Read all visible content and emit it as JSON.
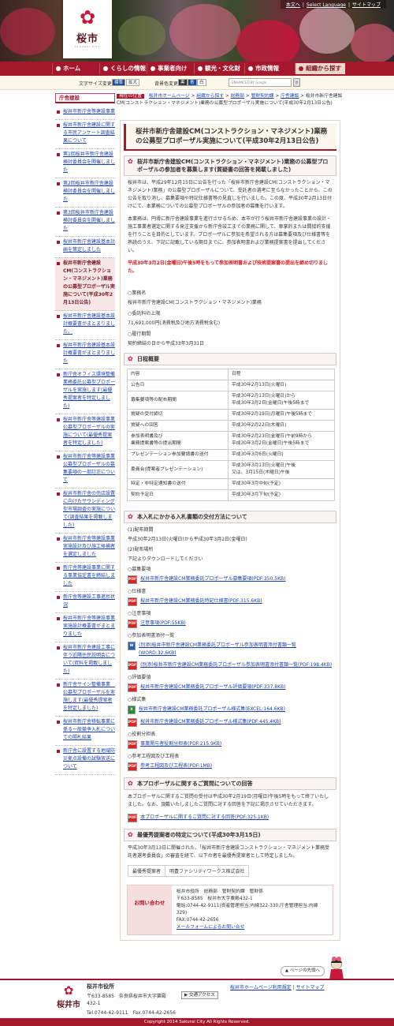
{
  "header": {
    "logo_name": "桜市",
    "logo_sub": "SAKURAI CITY",
    "top_links": [
      "本文へ",
      "Select Language",
      "サイトマップ"
    ]
  },
  "nav": [
    "ホーム",
    "くらしの情報",
    "事業者向け",
    "観光・文化財",
    "市政情報",
    "組織から探す"
  ],
  "toolbar": {
    "font_label": "文字サイズ変更",
    "font_std": "標準",
    "font_big": "拡大",
    "color_label": "背景色変更",
    "color_black": "黒",
    "color_blue": "青",
    "color_white": "白",
    "search_placeholder": "ENHANCED BY Google"
  },
  "sidebar": {
    "title": "庁舎建設",
    "items": [
      "桜井市新庁舎等建設事業",
      "桜井市新庁舎建設に関する市民アンケート調査結果について",
      "第1回桜井市新庁舎建設検討委員会を開催しました",
      "第2回桜井市新庁舎建設検討委員会を開催しました",
      "第3回桜井市新庁舎建設検討委員会を開催しました",
      "桜井市新庁舎建設基本計画を策定しました",
      "桜井市新庁舎建設CM(コンストラクション・マネジメント)業務の公募型プロポーザル実施について(平成30年2月13日公告)",
      "桜井市新庁舎建設基本設計概要書がまとまりました。",
      "桜井市新庁舎建設基本設計概要書がまとまりました",
      "新庁舎オフィス環境整備業務委託公募型プロポーザルを実施します(最優秀提案者を特定しました)",
      "桜井市新庁舎等建設事業公募型プロポーザルの実施について(最優秀提案者を特定しました)",
      "桜井市新庁舎等建設事業公募型プロポーザルの募集要項の一部訂正について",
      "桜井市新庁舎の売店設置に向けたサウンディング型市場調査の実施について(調査結果を掲載しました)",
      "桜井市新庁舎等建設事業実施設計及び施工候補者を選定しました",
      "新庁舎等建設事業に関する事業協定書を締結しました",
      "新庁舎等建設工事進捗状況",
      "桜井市新庁舎等建設事業実施設計概要書がまとまりました",
      "桜井市新庁舎建設工事に伴う近隣住民説明会について(資料を掲載しました)",
      "新庁舎サイン整備事業　公募型プロポーザルを実施します(最優秀提案者を特定しました)",
      "桜井市新庁舎移転事業に係る一般競争入札についての開札結果",
      "新庁舎に設置する地域防災拠点設備の試験放送について"
    ],
    "current": 6
  },
  "crumb": {
    "here": "現在の位置",
    "items": [
      "桜井市ホームページ",
      "組織から探す",
      "総務部",
      "管財契約課",
      "庁舎建設"
    ],
    "current": "桜井市新庁舎建設CM(コンストラクション・マネジメント)業務の公募型プロポーザル実施について(平成30年2月13日公告)"
  },
  "main": {
    "title": "桜井市新庁舎建設CM(コンストラクション・マネジメント)業務の公募型プロポーザル実施について(平成30年2月13日公告)",
    "h_intro": "桜井市新庁舎建設CM(コンストラクション・マネジメント)業務の公募型プロポーザルの参加者を募集します(質疑書の回答を掲載しました)",
    "p1": "桜井市は、平成29年12月15日に公告を行った「桜井市新庁舎建設CM(コンストラクション・マネジメント)業務」の公募型プロポーザルについて、受託者の選考に至らなかったことから、この公告を取り消し、募集要項や特記仕様書等の見直しを行いました。この度、平成30年2月13日付けにて、本業務についての公募型プロポーザルの参加者の募集を行います。",
    "p2": "本業務は、円滑に新庁舎建設事業を進行させるため、本市が行う桜井市新庁舎建設事業の設計・施工事業者選定に関する発注支援から新庁舎竣工までの業務に関して、車掌的または間接的支援を行うことを目的としています。プロポーザルに参加を希望される方は募集要項及び仕様書等を熟読のうえ、下記に記載している期日までに、参加表明書および業務提案書を提出してください。",
    "deadline": "平成30年3月2日(金曜日)午後5時をもって参加表明書および技術提案書の提出を締め切りました。",
    "lines": [
      "○業務名",
      "桜井市新庁舎建設CM(コンストラクション・マネジメント)業務",
      "○委託料の上限",
      "71,691,000円(消費税及び地方消費税含む)",
      "○履行期間",
      "契約締結の日から平成33年3月31日"
    ],
    "h_sched": "日程概要",
    "schedule": [
      [
        "内容",
        "日程"
      ],
      [
        "公告日",
        "平成30年2月13日(火曜日)"
      ],
      [
        "募集要項等の配布期間",
        "平成30年2月13日(火曜日)から\n平成30年3月2日(金曜日)午後5時まで"
      ],
      [
        "質疑の受付締切",
        "平成30年2月19日(月曜日)午後5時まで"
      ],
      [
        "質疑への回答",
        "平成30年2月22日(木曜日)"
      ],
      [
        "参加表明書及び\n業務提案書等の提出期間",
        "平成30年2月23日(金曜日)午前9時から\n平成30年3月2日(金曜日)午後5時まで"
      ],
      [
        "プレゼンテーション参加要請書の送付",
        "平成30年3月6日(火曜日)"
      ],
      [
        "委員会(提案者プレゼンテーション)",
        "平成30年3月13日(火曜日)午後\n又は、3月15日(木曜日)午後"
      ],
      [
        "特定・非特定通知書の送付",
        "平成30年3月中旬(予定)"
      ],
      [
        "契約予定日",
        "平成30年3月下旬(予定)"
      ]
    ],
    "h_dist": "本入札にかかる入札書類の交付方法について",
    "dist_lines": [
      "(1)配布期間",
      "平成30年2月13日(火曜日)から平成30年3月2日(金曜日)",
      "(2)配布場所",
      "下記よりダウンロードしてください"
    ],
    "docs": [
      {
        "sec": "○募集要項",
        "files": [
          {
            "t": "pdf",
            "n": "桜井市新庁舎建設CM業務委託プロポーザル募集要項(PDF:350.5KB)"
          }
        ]
      },
      {
        "sec": "○仕様書",
        "files": [
          {
            "t": "pdf",
            "n": "桜井市新庁舎建設CM業務委託特記仕様書(PDF:315.6KB)"
          }
        ]
      },
      {
        "sec": "○注意事項",
        "files": [
          {
            "t": "pdf",
            "n": "注意事項(PDF:55KB)"
          }
        ]
      },
      {
        "sec": "○参加表明書添付一覧",
        "files": [
          {
            "t": "word",
            "n": "(別添)桜井市新庁舎建設CM業務委託プロポーザル参加表明書添付書類一覧(WORD:32.6KB)"
          },
          {
            "t": "pdf",
            "n": "(別添)桜井市新庁舎建設CM業務委託プロポーザル参加表明書添付書類一覧(PDF:198.4KB)"
          }
        ]
      },
      {
        "sec": "○評価要領",
        "files": [
          {
            "t": "pdf",
            "n": "桜井市新庁舎建設CM業務委託プロポーザル評価要領(PDF:337.8KB)"
          }
        ]
      },
      {
        "sec": "○様式集",
        "files": [
          {
            "t": "xls",
            "n": "桜井市新庁舎建設CM業務委託プロポーザル様式集(EXCEL:164.6KB)"
          },
          {
            "t": "pdf",
            "n": "桜井市新庁舎建設CM業務委託プロポーザル様式集(PDF:445.4KB)"
          }
        ]
      },
      {
        "sec": "○役割分担表",
        "files": [
          {
            "t": "pdf",
            "n": "事業関与者役割分担表(PDF:215.9KB)"
          }
        ]
      },
      {
        "sec": "○参考工程図及び工程表",
        "files": [
          {
            "t": "pdf",
            "n": "参考工程図及び工程表(PDF:1MB)"
          }
        ]
      }
    ],
    "h_qa": "本プロポーザルに関するご質問についての回答",
    "qa_text": "本プロポーザルに関するご質問の受付は平成30年2月19日(月曜日)午後5時をもって終了いたしました。なお、頂戴いたしましたご質問に対する回答を下記に掲示させていただきます。",
    "qa_file": "本プロポーザルに関するご質問に対する回答(PDF:325.1KB)",
    "h_best": "最優秀提案者の特定について(平成30年3月15日)",
    "best_text": "平成30年3月13日に開催された、「桜井市新庁舎建設コンストラクション・マネジメント業務受託者選考委員会」の審査を経て、以下の者を最優秀提案者として特定しました。",
    "best_label": "最優秀提案者",
    "best_value": "明豊ファシリティワークス株式会社",
    "inq_label": "お問い合わせ",
    "inq_lines": [
      "桜井市役所　総務部　管財契約課　管財係",
      "〒633-8585　桜井市大字粟殿432-1",
      "電話:0744-42-9111(資産管理担当:内線322-330,庁舎管理担当:内線329)",
      "FAX:0744-42-2656"
    ],
    "inq_mail": "メールフォームによるお問い合せ"
  },
  "footer": {
    "pagetop": "ページの先頭へ",
    "logo": "桜井市",
    "office": "桜井市役所",
    "addr1": "〒633-8585　奈良県桜井市大字粟殿",
    "addr2": "432-1",
    "tel": "Tel.0744-42-9111　Fax.0744-42-2656",
    "access": "交通アクセス",
    "links": [
      "桜井市ホームページ利用規定",
      "サイトマップ"
    ],
    "copyright": "Copyright 2014 Sakurai City All Rights Reserved."
  }
}
